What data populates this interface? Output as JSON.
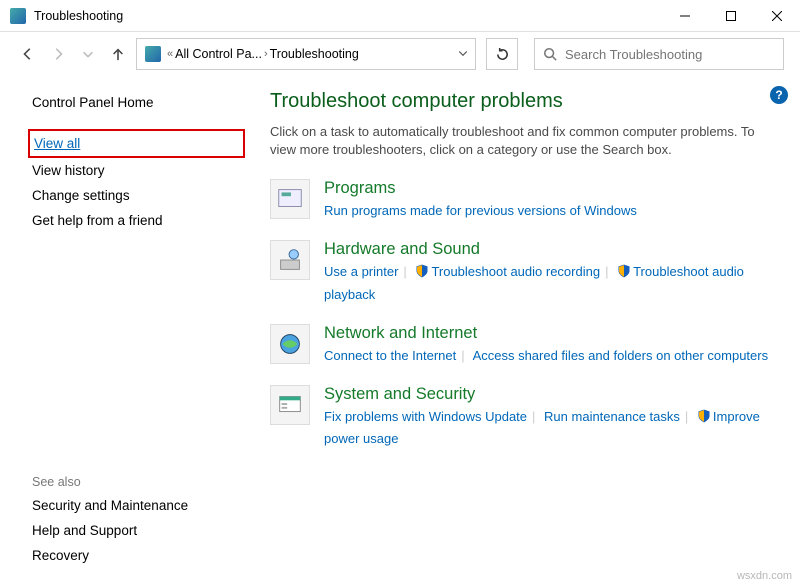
{
  "titlebar": {
    "title": "Troubleshooting"
  },
  "addressbar": {
    "seg1": "All Control Pa...",
    "seg2": "Troubleshooting"
  },
  "search": {
    "placeholder": "Search Troubleshooting"
  },
  "sidebar": {
    "home": "Control Panel Home",
    "items": [
      "View all",
      "View history",
      "Change settings",
      "Get help from a friend"
    ]
  },
  "seealso": {
    "heading": "See also",
    "items": [
      "Security and Maintenance",
      "Help and Support",
      "Recovery"
    ]
  },
  "page": {
    "title": "Troubleshoot computer problems",
    "desc": "Click on a task to automatically troubleshoot and fix common computer problems. To view more troubleshooters, click on a category or use the Search box."
  },
  "categories": [
    {
      "title": "Programs",
      "links": [
        {
          "text": "Run programs made for previous versions of Windows",
          "shield": false
        }
      ]
    },
    {
      "title": "Hardware and Sound",
      "links": [
        {
          "text": "Use a printer",
          "shield": false
        },
        {
          "text": "Troubleshoot audio recording",
          "shield": true
        },
        {
          "text": "Troubleshoot audio playback",
          "shield": true
        }
      ]
    },
    {
      "title": "Network and Internet",
      "links": [
        {
          "text": "Connect to the Internet",
          "shield": false
        },
        {
          "text": "Access shared files and folders on other computers",
          "shield": false
        }
      ]
    },
    {
      "title": "System and Security",
      "links": [
        {
          "text": "Fix problems with Windows Update",
          "shield": false
        },
        {
          "text": "Run maintenance tasks",
          "shield": false
        },
        {
          "text": "Improve power usage",
          "shield": true
        }
      ]
    }
  ],
  "watermark": "wsxdn.com"
}
